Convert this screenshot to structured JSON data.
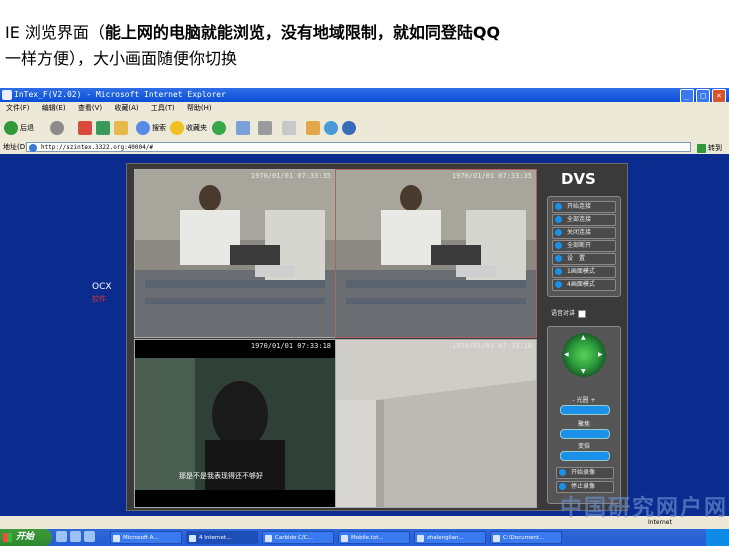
{
  "headline": {
    "line1_plain": "IE 浏览界面（",
    "line1_bold": "能上网的电脑就能浏览，没有地域限制，就如同登陆QQ",
    "line2": "一样方便），大小画面随便你切换"
  },
  "window": {
    "title": "InTex_F(V2.02) - Microsoft Internet Explorer",
    "buttons": [
      "_",
      "□",
      "×"
    ]
  },
  "menu": [
    "文件(F)",
    "编辑(E)",
    "查看(V)",
    "收藏(A)",
    "工具(T)",
    "帮助(H)"
  ],
  "toolbar": {
    "back": "后退",
    "search": "搜索",
    "favorites": "收藏夹"
  },
  "address": {
    "label": "地址(D)",
    "url": "http://szintex.3322.org:40004/#",
    "go": "转到"
  },
  "dvs": {
    "logo": "DVS",
    "timestamps": [
      "1970/01/01 07:33:35",
      "1970/01/01 07:33:35",
      "1970/01/01 07:33:18",
      "1970/01/01 07:33:18"
    ],
    "subtitle": "那是不是我表现得还不够好",
    "buttons": [
      "开始连接",
      "全部连接",
      "关闭连接",
      "全部断开",
      "设　置",
      "1画面模式",
      "4画面模式"
    ],
    "talk_label": "语音对讲",
    "ptz": {
      "focus": "- 光圈 +",
      "zoom": "聚焦",
      "label3": "变倍",
      "record_start": "开始录像",
      "record_stop": "停止录像"
    }
  },
  "ocx": {
    "label": "OCX",
    "sub": "控件"
  },
  "watermark": "中国研究网户网",
  "status": {
    "zone": "Internet"
  },
  "taskbar": {
    "start": "开始",
    "items": [
      "Microsoft A...",
      "4 Internet...",
      "Carbide C/C...",
      "Mobile.txt...",
      "zhalenglian...",
      "C:\\Document..."
    ]
  }
}
